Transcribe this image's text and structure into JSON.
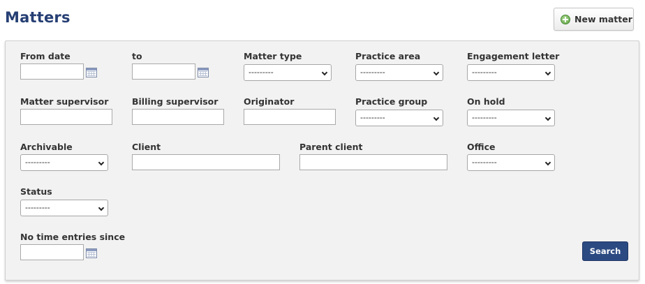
{
  "header": {
    "title": "Matters",
    "new_matter_label": "New matter"
  },
  "filters": {
    "from_date": {
      "label": "From date",
      "value": ""
    },
    "to": {
      "label": "to",
      "value": ""
    },
    "matter_type": {
      "label": "Matter type",
      "selected": "---------"
    },
    "practice_area": {
      "label": "Practice area",
      "selected": "---------"
    },
    "engagement_letter": {
      "label": "Engagement letter",
      "selected": "---------"
    },
    "matter_supervisor": {
      "label": "Matter supervisor",
      "value": ""
    },
    "billing_supervisor": {
      "label": "Billing supervisor",
      "value": ""
    },
    "originator": {
      "label": "Originator",
      "value": ""
    },
    "practice_group": {
      "label": "Practice group",
      "selected": "---------"
    },
    "on_hold": {
      "label": "On hold",
      "selected": "---------"
    },
    "archivable": {
      "label": "Archivable",
      "selected": "---------"
    },
    "client": {
      "label": "Client",
      "value": ""
    },
    "parent_client": {
      "label": "Parent client",
      "value": ""
    },
    "office": {
      "label": "Office",
      "selected": "---------"
    },
    "status": {
      "label": "Status",
      "selected": "---------"
    },
    "no_time_entries_since": {
      "label": "No time entries since",
      "value": ""
    }
  },
  "actions": {
    "search_label": "Search"
  },
  "icons": {
    "new_matter": "plus-circle-icon",
    "date_picker": "calendar-icon",
    "dropdown": "chevron-down-icon"
  },
  "colors": {
    "title": "#263f74",
    "primary_button": "#2b4a82",
    "panel_background": "#f2f2f2"
  }
}
